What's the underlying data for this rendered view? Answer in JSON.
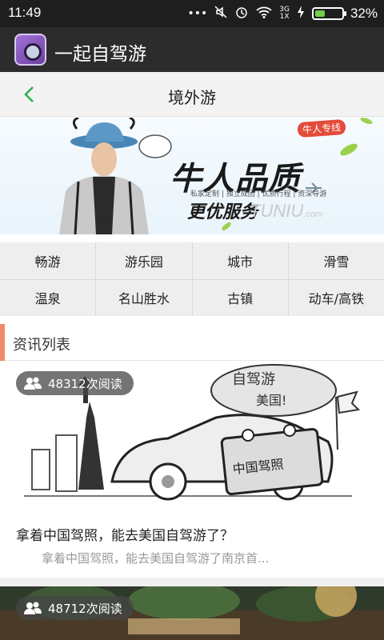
{
  "status_bar": {
    "time": "11:49",
    "network": "3G\n1X",
    "battery_percent": "32%",
    "battery_level": 0.32,
    "icons": [
      "more-dots-icon",
      "mute-icon",
      "alarm-icon",
      "wifi-icon",
      "signal-icon",
      "charging-icon",
      "battery-icon"
    ]
  },
  "app_bar": {
    "title": "一起自驾游",
    "logo_icon": "app-logo-icon"
  },
  "page_header": {
    "title": "境外游",
    "back_icon": "chevron-left-icon",
    "accent_color": "#2bb24c"
  },
  "banner": {
    "tag": "牛人专线",
    "slogan_main": "牛人品质",
    "slogan_sub": "私家定制 | 独立成团 | 优质行程 | 资深导游",
    "slogan_secondary": "更优服务",
    "brand": "TUNIU",
    "brand_suffix": ".com"
  },
  "categories": [
    {
      "label": "畅游"
    },
    {
      "label": "游乐园"
    },
    {
      "label": "城市"
    },
    {
      "label": "滑雪"
    },
    {
      "label": "温泉"
    },
    {
      "label": "名山胜水"
    },
    {
      "label": "古镇"
    },
    {
      "label": "动车/高铁"
    }
  ],
  "section": {
    "title": "资讯列表",
    "accent_color": "#f08a6a"
  },
  "news": [
    {
      "reads": "48312次阅读",
      "title": "拿着中国驾照，能去美国自驾游了？",
      "summary": "拿着中国驾照，能去美国自驾游了南京首...",
      "image_text_1": "自驾游",
      "image_text_2": "美国!",
      "image_text_3": "中国驾照"
    },
    {
      "reads": "48712次阅读"
    }
  ]
}
